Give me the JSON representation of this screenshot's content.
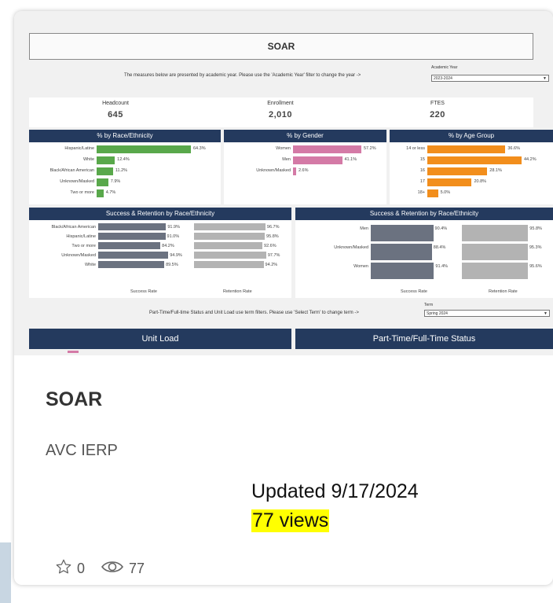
{
  "dashboard": {
    "title": "SOAR",
    "year_note": "The measures below are presented by academic year. Please use the 'Academic Year' filter to change the year ->",
    "year_filter_label": "Academic Year",
    "year_filter_value": "2023-2024",
    "kpis": [
      {
        "label": "Headcount",
        "value": "645"
      },
      {
        "label": "Enrollment",
        "value": "2,010"
      },
      {
        "label": "FTES",
        "value": "220"
      }
    ],
    "race_panel": {
      "title": "% by Race/Ethnicity",
      "rows": [
        {
          "label": "Hispanic/Latine",
          "value": "64.3%",
          "pct": 64.3
        },
        {
          "label": "White",
          "value": "12.4%",
          "pct": 12.4
        },
        {
          "label": "Black/African American",
          "value": "11.2%",
          "pct": 11.2
        },
        {
          "label": "Unknown/Masked",
          "value": "7.9%",
          "pct": 7.9
        },
        {
          "label": "Two or more",
          "value": "4.7%",
          "pct": 4.7
        }
      ]
    },
    "gender_panel": {
      "title": "% by Gender",
      "rows": [
        {
          "label": "Women",
          "value": "57.2%",
          "pct": 57.2
        },
        {
          "label": "Men",
          "value": "41.1%",
          "pct": 41.1
        },
        {
          "label": "Unknown/Masked",
          "value": "2.6%",
          "pct": 2.6
        }
      ]
    },
    "age_panel": {
      "title": "% by Age Group",
      "rows": [
        {
          "label": "14 or less",
          "value": "36.6%",
          "pct": 36.6
        },
        {
          "label": "15",
          "value": "44.2%",
          "pct": 44.2
        },
        {
          "label": "16",
          "value": "28.1%",
          "pct": 28.1
        },
        {
          "label": "17",
          "value": "20.8%",
          "pct": 20.8
        },
        {
          "label": "18+",
          "value": "5.0%",
          "pct": 5.0
        }
      ]
    },
    "sr_race_panel": {
      "title": "Success & Retention by Race/Ethnicity",
      "rows": [
        {
          "label": "Black/African American",
          "success": "91.9%",
          "retention": "96.7%",
          "s": 91.9,
          "r": 96.7
        },
        {
          "label": "Hispanic/Latine",
          "success": "91.0%",
          "retention": "95.8%",
          "s": 91.0,
          "r": 95.8
        },
        {
          "label": "Two or more",
          "success": "84.2%",
          "retention": "92.6%",
          "s": 84.2,
          "r": 92.6
        },
        {
          "label": "Unknown/Masked",
          "success": "94.9%",
          "retention": "97.7%",
          "s": 94.9,
          "r": 97.7
        },
        {
          "label": "White",
          "success": "89.5%",
          "retention": "94.2%",
          "s": 89.5,
          "r": 94.2
        }
      ],
      "col1": "Success Rate",
      "col2": "Retention Rate"
    },
    "sr_gender_panel": {
      "title": "Success & Retention by Race/Ethnicity",
      "rows": [
        {
          "label": "Men",
          "success": "90.4%",
          "retention": "95.8%",
          "s": 90.4,
          "r": 95.8
        },
        {
          "label": "Unknown/Masked",
          "success": "88.4%",
          "retention": "95.3%",
          "s": 88.4,
          "r": 95.3
        },
        {
          "label": "Women",
          "success": "91.4%",
          "retention": "95.6%",
          "s": 91.4,
          "r": 95.6
        }
      ],
      "col1": "Success Rate",
      "col2": "Retention Rate"
    },
    "term_note": "Part-Time/Full-time Status and Unit Load use term filters. Please use 'Select Term' to change term ->",
    "term_filter_label": "Term",
    "term_filter_value": "Spring 2024",
    "bottom_panels": [
      "Unit Load",
      "Part-Time/Full-Time Status"
    ],
    "colors": {
      "header": "#243a5e",
      "race": "#59a84b",
      "gender": "#d47aa6",
      "age": "#f28e1c",
      "success": "#6b7280",
      "retention": "#b3b3b3"
    }
  },
  "card": {
    "title": "SOAR",
    "author": "AVC IERP",
    "favorites": "0",
    "views_count": "77"
  },
  "annotation": {
    "updated": "Updated 9/17/2024",
    "views": "77 views"
  }
}
